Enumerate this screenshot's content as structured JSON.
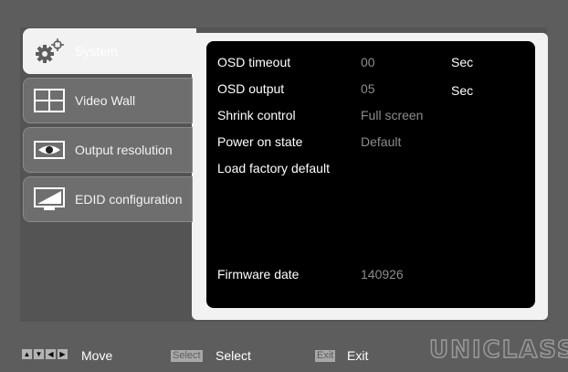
{
  "sidebar": {
    "tabs": [
      {
        "label": "System",
        "icon": "gear-icon",
        "active": true
      },
      {
        "label": "Video Wall",
        "icon": "grid-icon",
        "active": false
      },
      {
        "label": "Output resolution",
        "icon": "eye-icon",
        "active": false
      },
      {
        "label": "EDID configuration",
        "icon": "monitor-icon",
        "active": false
      }
    ]
  },
  "settings": [
    {
      "label": "OSD timeout",
      "value": "00",
      "unit": "Sec"
    },
    {
      "label": "OSD output",
      "value": "05",
      "unit": "Sec"
    },
    {
      "label": "Shrink control",
      "value": "Full screen",
      "unit": ""
    },
    {
      "label": "Power on state",
      "value": "Default",
      "unit": ""
    },
    {
      "label": "Load factory default",
      "value": "",
      "unit": ""
    }
  ],
  "firmware": {
    "label": "Firmware date",
    "value": "140926"
  },
  "footer": {
    "move_label": "Move",
    "select_key": "Select",
    "select_label": "Select",
    "exit_key": "Exit",
    "exit_label": "Exit"
  },
  "logo": "UNICLASS",
  "colors": {
    "background": "#5d5d5d",
    "panel": "#000000",
    "active_tab": "#f2f2f2",
    "value_text": "#8c8c8c"
  }
}
